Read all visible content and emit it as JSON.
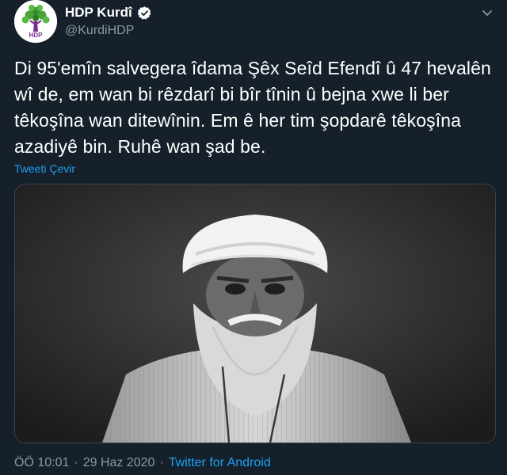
{
  "account": {
    "display_name": "HDP Kurdî",
    "handle": "@KurdiHDP",
    "verified": true,
    "avatar_text": "HDP"
  },
  "tweet": {
    "text": "Di 95'emîn salvegera îdama Şêx Seîd Efendî û 47 hevalên wî de, em wan bi rêzdarî bi bîr tînin û bejna xwe li ber têkoşîna wan ditewînin. Em ê her tim şopdarê têkoşîna azadiyê bin. Ruhê wan şad be.",
    "translate_label": "Tweeti Çevir",
    "time": "ÖÖ 10:01",
    "separator": "·",
    "date": "29 Haz 2020",
    "source": "Twitter for Android"
  },
  "colors": {
    "background": "#15202b",
    "text": "#ffffff",
    "secondary": "#8899a6",
    "link": "#1da1f2",
    "border": "#38444d"
  },
  "icons": {
    "verified": "verified-badge-icon",
    "caret": "chevron-down-icon",
    "avatar": "hdp-tree-logo-icon"
  }
}
